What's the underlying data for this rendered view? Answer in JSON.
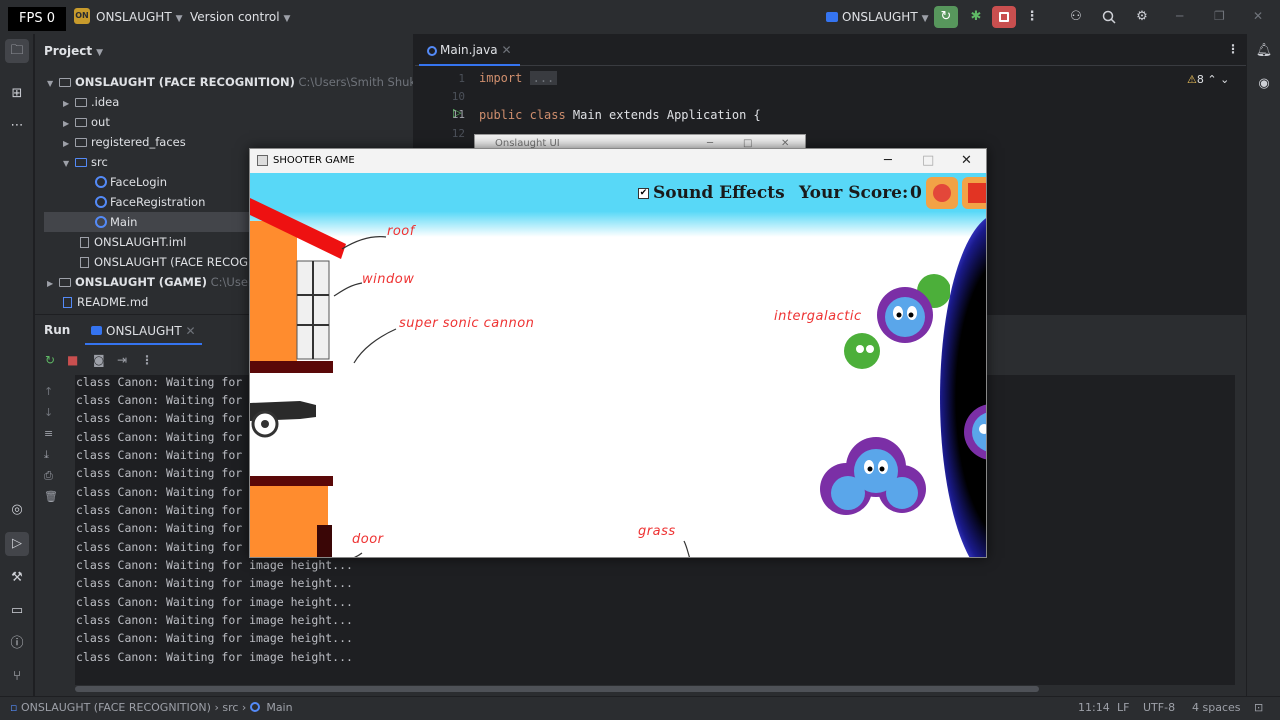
{
  "titlebar": {
    "fps": "FPS 0",
    "project_badge": "ON",
    "project_name": "ONSLAUGHT",
    "vcs_label": "Version control",
    "run_config": "ONSLAUGHT"
  },
  "project_panel": {
    "title": "Project",
    "tree": [
      {
        "label": "ONSLAUGHT (FACE RECOGNITION)",
        "path": "C:\\Users\\Smith Shukla\\On"
      },
      {
        "label": ".idea"
      },
      {
        "label": "out"
      },
      {
        "label": "registered_faces"
      },
      {
        "label": "src"
      },
      {
        "label": "FaceLogin"
      },
      {
        "label": "FaceRegistration"
      },
      {
        "label": "Main"
      },
      {
        "label": "ONSLAUGHT.iml"
      },
      {
        "label": "ONSLAUGHT (FACE RECOGNI"
      },
      {
        "label": "ONSLAUGHT (GAME)",
        "path": "C:\\Users"
      },
      {
        "label": "README.md"
      }
    ]
  },
  "editor": {
    "tab": "Main.java",
    "lines": [
      {
        "num": "1",
        "kw": "import",
        "rest": "..."
      },
      {
        "num": "10",
        "kw": "",
        "rest": ""
      },
      {
        "num": "11",
        "kw": "public class",
        "rest": " Main extends Application {"
      },
      {
        "num": "12",
        "kw": "",
        "rest": ""
      }
    ],
    "warnings": "8"
  },
  "behind_window_title": "Onslaught UI",
  "run_panel": {
    "title": "Run",
    "tab": "ONSLAUGHT",
    "console": [
      "class Canon: Waiting for i",
      "class Canon: Waiting for i",
      "class Canon: Waiting for i",
      "class Canon: Waiting for i",
      "class Canon: Waiting for i",
      "class Canon: Waiting for i",
      "class Canon: Waiting for i",
      "class Canon: Waiting for i",
      "class Canon: Waiting for i",
      "class Canon: Waiting for i",
      "class Canon: Waiting for image height...",
      "class Canon: Waiting for image height...",
      "class Canon: Waiting for image height...",
      "class Canon: Waiting for image height...",
      "class Canon: Waiting for image height...",
      "class Canon: Waiting for image height..."
    ]
  },
  "statusbar": {
    "crumbs": [
      "ONSLAUGHT (FACE RECOGNITION)",
      "src",
      "Main"
    ],
    "position": "11:14",
    "line_sep": "LF",
    "encoding": "UTF-8",
    "indent": "4 spaces"
  },
  "game": {
    "window_title": "SHOOTER GAME",
    "sound_check": "✔",
    "sound_label": "Sound Effects",
    "score_label": "Your Score:",
    "score_value": "0",
    "annotations": {
      "roof": "roof",
      "window": "window",
      "cannon": "super sonic cannon",
      "aliens": "intergalactic",
      "door": "door",
      "grass": "grass"
    },
    "colors": {
      "sky": "#58d8f7",
      "house": "#ff8c2e",
      "roof": "#ee1111",
      "annotation": "#ee3333"
    }
  }
}
